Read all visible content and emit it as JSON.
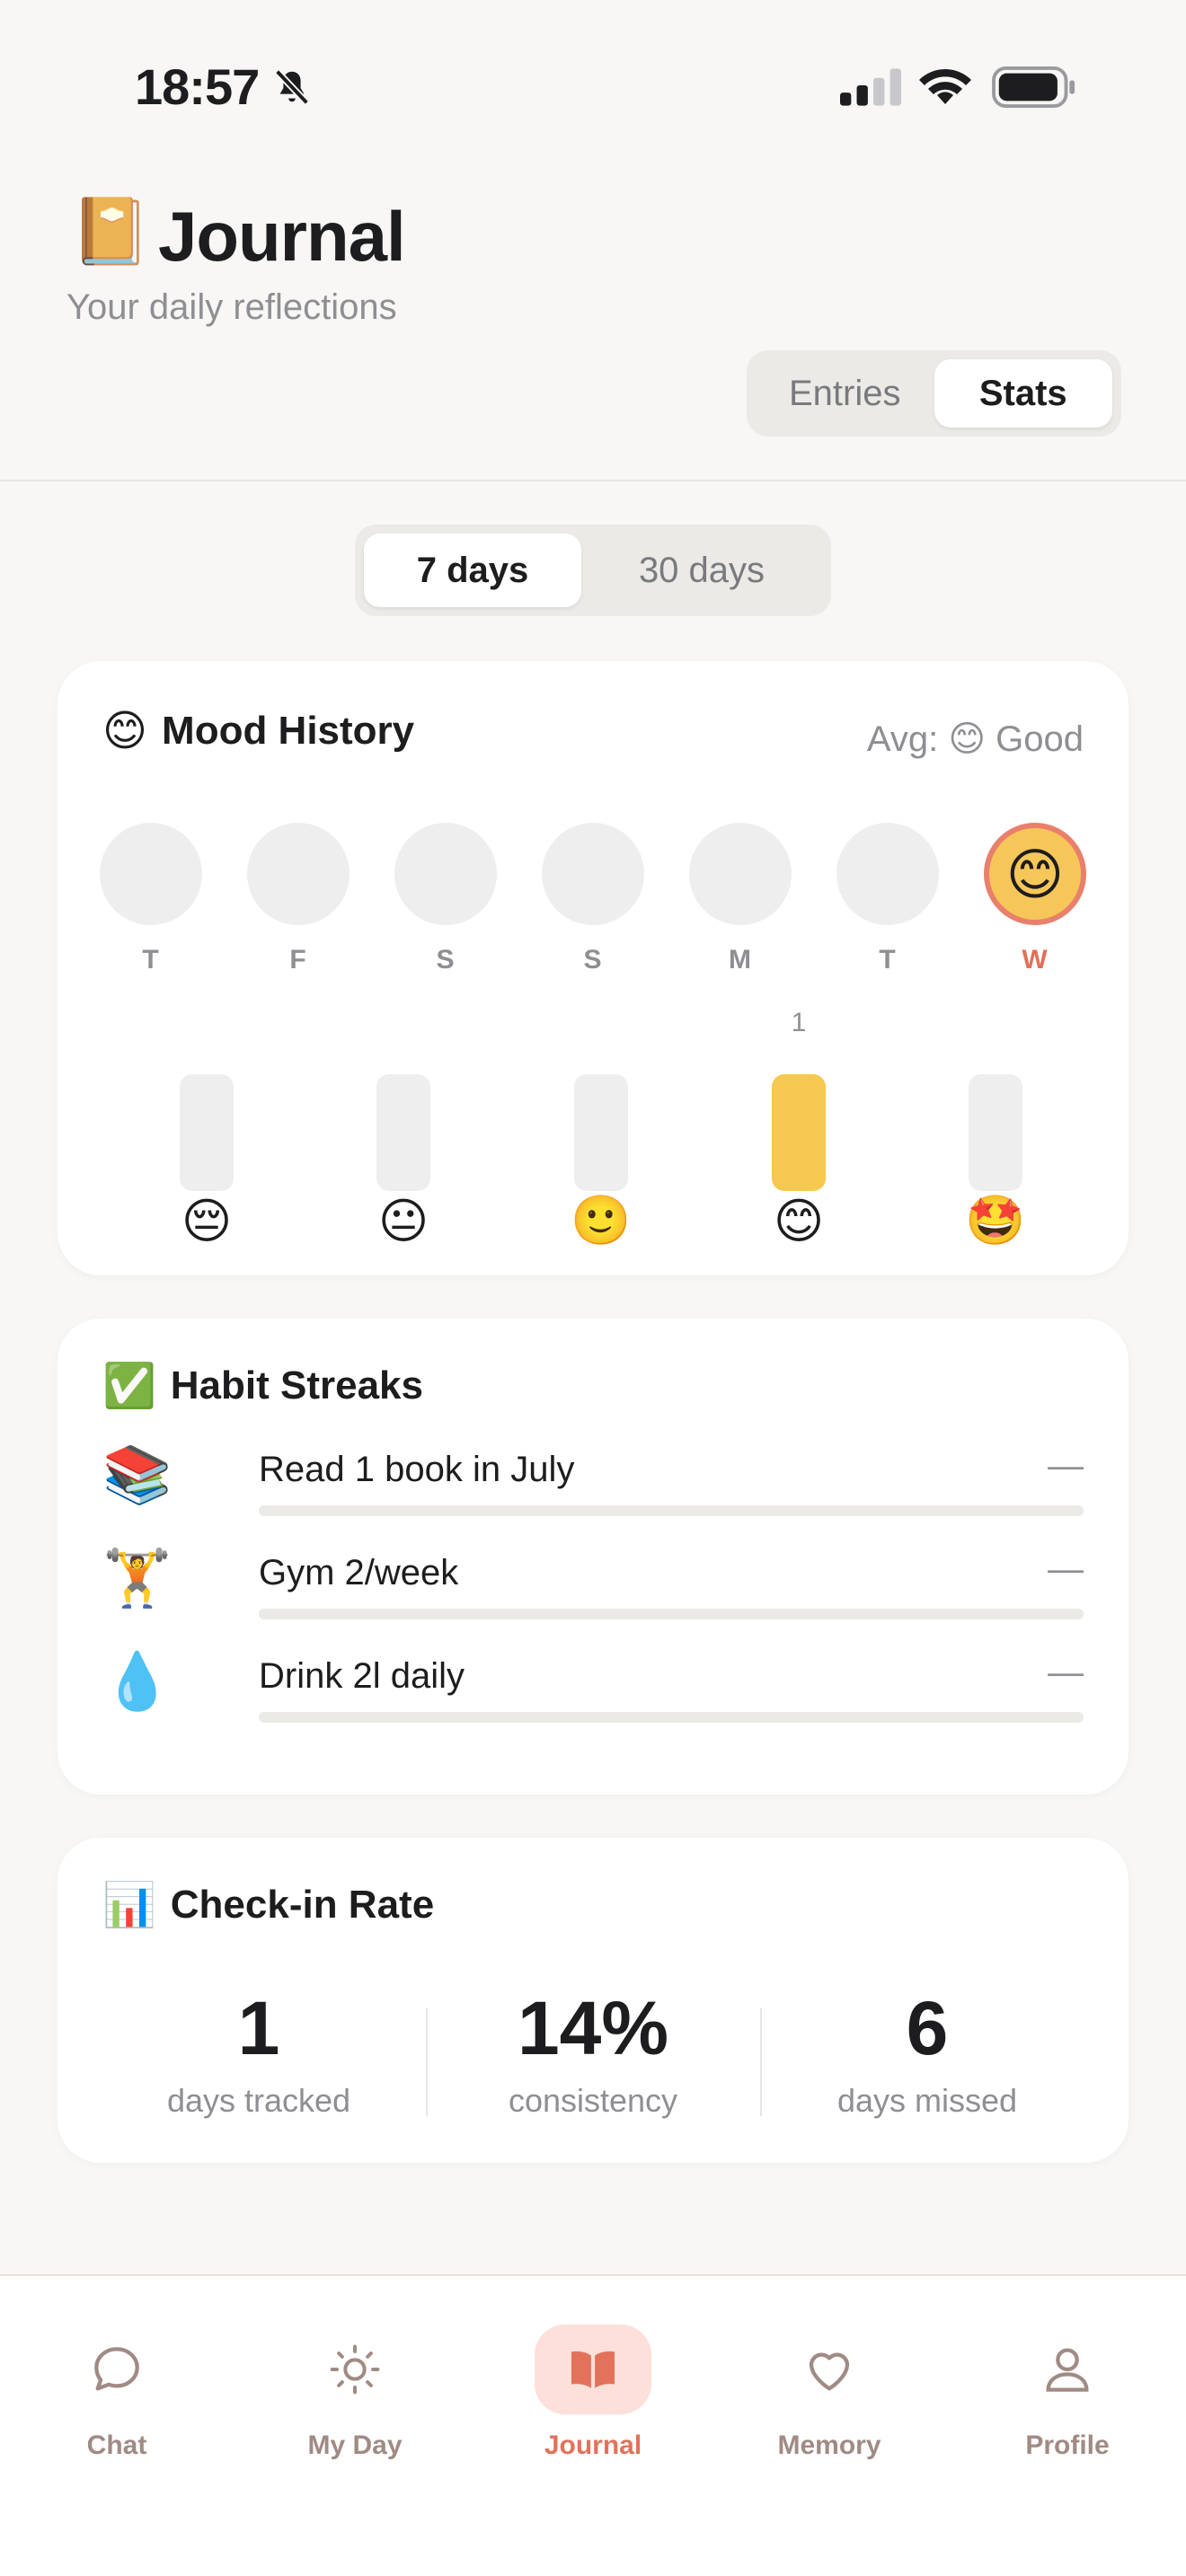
{
  "status_bar": {
    "time": "18:57"
  },
  "header": {
    "icon": "📔",
    "title": "Journal",
    "subtitle": "Your daily reflections",
    "segments": [
      "Entries",
      "Stats"
    ],
    "active_segment": "Stats"
  },
  "range": {
    "options": [
      "7 days",
      "30 days"
    ],
    "active": "7 days"
  },
  "mood_history": {
    "icon": "😊",
    "title": "Mood History",
    "avg_label": "Avg:",
    "avg_emoji": "😊",
    "avg_text": "Good",
    "days": [
      {
        "label": "T",
        "emoji": ""
      },
      {
        "label": "F",
        "emoji": ""
      },
      {
        "label": "S",
        "emoji": ""
      },
      {
        "label": "S",
        "emoji": ""
      },
      {
        "label": "M",
        "emoji": ""
      },
      {
        "label": "T",
        "emoji": ""
      },
      {
        "label": "W",
        "emoji": "😊",
        "today": true
      }
    ],
    "distribution": [
      {
        "emoji": "😔",
        "count": 0,
        "count_label": ""
      },
      {
        "emoji": "😐",
        "count": 0,
        "count_label": ""
      },
      {
        "emoji": "🙂",
        "count": 0,
        "count_label": ""
      },
      {
        "emoji": "😊",
        "count": 1,
        "count_label": "1"
      },
      {
        "emoji": "🤩",
        "count": 0,
        "count_label": ""
      }
    ]
  },
  "habit_streaks": {
    "icon": "✅",
    "title": "Habit Streaks",
    "habits": [
      {
        "icon": "📚",
        "label": "Read 1 book in July",
        "streak": "—",
        "progress": 0
      },
      {
        "icon": "🏋️",
        "label": "Gym 2/week",
        "streak": "—",
        "progress": 0
      },
      {
        "icon": "💧",
        "label": "Drink 2l daily",
        "streak": "—",
        "progress": 0
      }
    ]
  },
  "checkin_rate": {
    "icon": "📊",
    "title": "Check-in Rate",
    "stats": [
      {
        "value": "1",
        "label": "days tracked"
      },
      {
        "value": "14%",
        "label": "consistency"
      },
      {
        "value": "6",
        "label": "days missed"
      }
    ]
  },
  "tab_bar": {
    "tabs": [
      {
        "label": "Chat",
        "icon": "chat-bubble-icon"
      },
      {
        "label": "My Day",
        "icon": "sun-icon"
      },
      {
        "label": "Journal",
        "icon": "book-icon",
        "active": true
      },
      {
        "label": "Memory",
        "icon": "heart-icon"
      },
      {
        "label": "Profile",
        "icon": "person-icon"
      }
    ]
  },
  "colors": {
    "accent": "#e2725b",
    "accent_bg": "#fce0d9",
    "bar_fill": "#f6c84f",
    "muted": "#8e8e93"
  }
}
